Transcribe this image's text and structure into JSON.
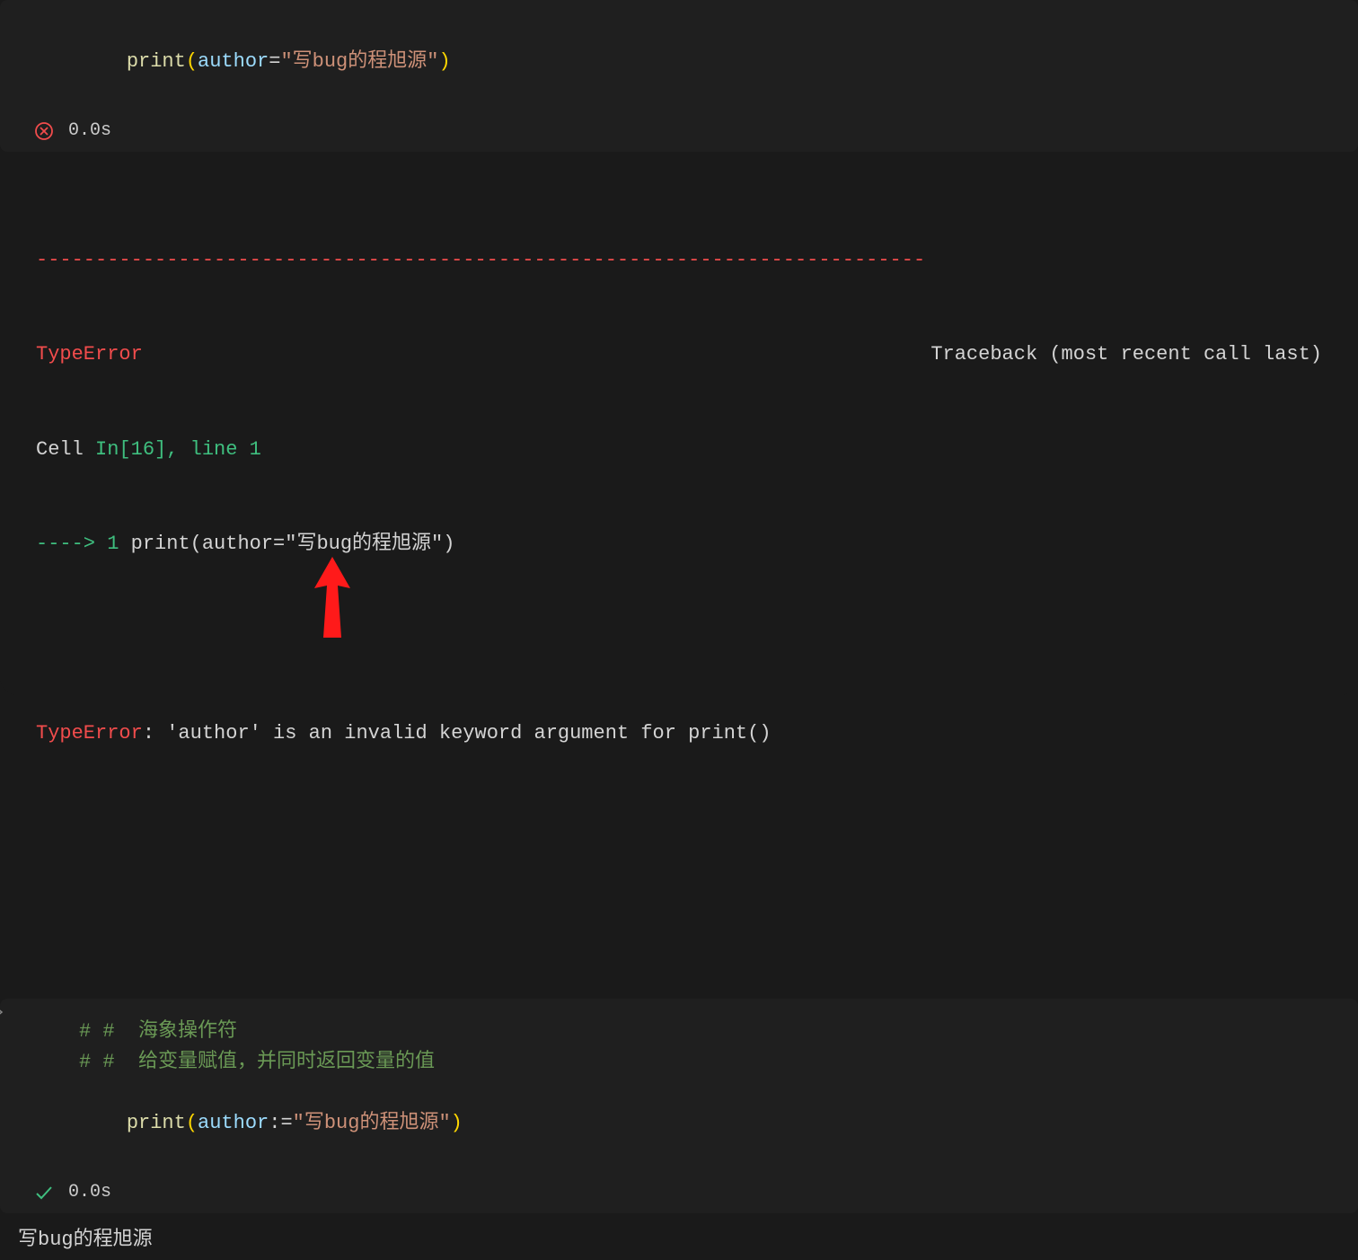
{
  "cell1": {
    "code": {
      "fn": "print",
      "lparen": "(",
      "arg": "author",
      "op": "=",
      "str": "\"写bug的程旭源\"",
      "rparen": ")"
    },
    "status_time": "0.0s"
  },
  "traceback": {
    "dashes": "---------------------------------------------------------------------------",
    "error_type": "TypeError",
    "traceback_label": "Traceback (most recent call last)",
    "cell_label_prefix": "Cell ",
    "cell_ref": "In[16], line 1",
    "arrow": "----> ",
    "lineno": "1",
    "code_echo": " print(author=\"写bug的程旭源\")",
    "error_type2": "TypeError",
    "error_msg": ": 'author' is an invalid keyword argument for print()"
  },
  "cell2": {
    "comment1": "# #  海象操作符",
    "comment2": "# #  给变量赋值，并同时返回变量的值",
    "code": {
      "fn": "print",
      "lparen": "(",
      "arg": "author",
      "op": ":=",
      "str": "\"写bug的程旭源\"",
      "rparen": ")"
    },
    "status_time": "0.0s",
    "output": "写bug的程旭源"
  },
  "icons": {
    "error": "error-circle",
    "success": "checkmark",
    "collapse": "chevron"
  }
}
